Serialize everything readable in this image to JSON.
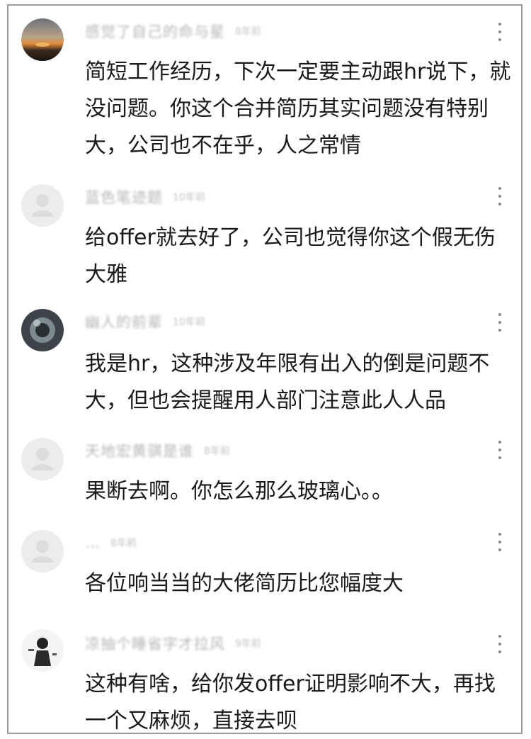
{
  "comments": [
    {
      "username": "感觉了自己的命与星",
      "time": "8年前",
      "avatar": "sunset-photo",
      "text": "简短工作经历，下次一定要主动跟hr说下，就没问题。你这个合并简历其实问题没有特别大，公司也不在乎，人之常情"
    },
    {
      "username": "蓝色笔迹题",
      "time": "10年前",
      "avatar": "default-avatar",
      "text": "给offer就去好了，公司也觉得你这个假无伤大雅"
    },
    {
      "username": "幽人的前辈",
      "time": "10年前",
      "avatar": "dark-photo",
      "text": "我是hr，这种涉及年限有出入的倒是问题不大，但也会提醒用人部门注意此人人品"
    },
    {
      "username": "天地宏黄骐是谁",
      "time": "8年前",
      "avatar": "default-avatar",
      "text": "果断去啊。你怎么那么玻璃心。。"
    },
    {
      "username": "…",
      "time": "8年前",
      "avatar": "default-avatar",
      "text": "各位响当当的大佬简历比您幅度大"
    },
    {
      "username": "凉抽个睡省字才拉风",
      "time": "9年前",
      "avatar": "figure-photo",
      "text": "这种有啥，给你发offer证明影响不大，再找一个又麻烦，直接去呗"
    }
  ]
}
